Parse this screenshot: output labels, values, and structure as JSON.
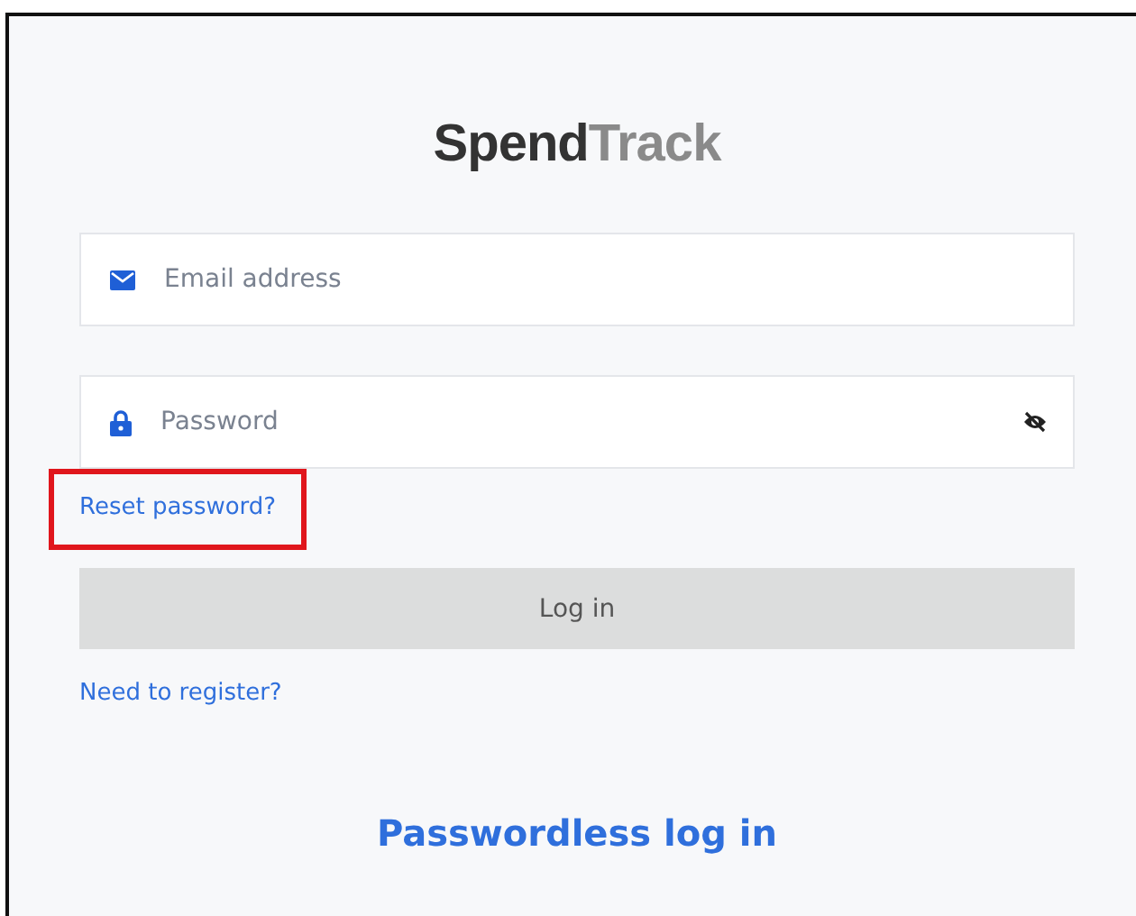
{
  "logo": {
    "part_1": "Spend",
    "part_2": "Track"
  },
  "fields": [
    {
      "kind": "email",
      "placeholder": "Email address"
    },
    {
      "kind": "password",
      "placeholder": "Password"
    }
  ],
  "reset_link": {
    "label": "Reset password?",
    "highlighted": true
  },
  "login_button": {
    "label": "Log in",
    "disabled": true
  },
  "register_link": {
    "label": "Need to register?"
  },
  "passwordless_link": {
    "label": "Passwordless log in"
  }
}
